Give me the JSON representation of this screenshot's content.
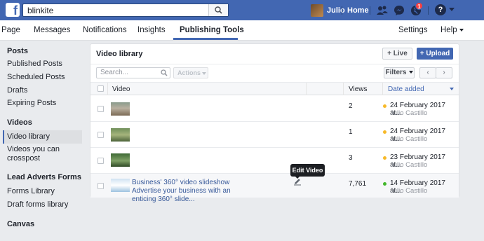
{
  "topbar": {
    "search_value": "blinkite",
    "profile_name": "Julio",
    "home_label": "Home",
    "notification_count": "1",
    "help_symbol": "?"
  },
  "pagenav": {
    "items": [
      "Page",
      "Messages",
      "Notifications",
      "Insights",
      "Publishing Tools"
    ],
    "active": "Publishing Tools",
    "settings_label": "Settings",
    "help_label": "Help"
  },
  "sidebar": {
    "sections": [
      {
        "heading": "Posts",
        "items": [
          "Published Posts",
          "Scheduled Posts",
          "Drafts",
          "Expiring Posts"
        ]
      },
      {
        "heading": "Videos",
        "items": [
          "Video library",
          "Videos you can crosspost"
        ]
      },
      {
        "heading": "Lead Adverts Forms",
        "items": [
          "Forms Library",
          "Draft forms library"
        ]
      },
      {
        "heading": "Canvas",
        "items": []
      }
    ],
    "active_item": "Video library"
  },
  "library": {
    "title": "Video library",
    "live_label": "Live",
    "upload_label": "Upload",
    "search_placeholder": "Search...",
    "actions_label": "Actions",
    "filters_label": "Filters",
    "columns": {
      "video": "Video",
      "views": "Views",
      "date": "Date added"
    },
    "rows": [
      {
        "title": "",
        "views": "2",
        "date": "24 February 2017 at...",
        "author": "Julio Castillo",
        "status_color": "#f7b928"
      },
      {
        "title": "",
        "views": "1",
        "date": "24 February 2017 at...",
        "author": "Julio Castillo",
        "status_color": "#f7b928"
      },
      {
        "title": "",
        "views": "3",
        "date": "23 February 2017 at...",
        "author": "Julio Castillo",
        "status_color": "#f7b928"
      },
      {
        "title": "Business' 360° video slideshow Advertise your business with an enticing 360° slide...",
        "views": "7,761",
        "date": "14 February 2017 at...",
        "author": "Julio Castillo",
        "status_color": "#42b72a"
      }
    ],
    "tooltip": "Edit Video"
  },
  "colors": {
    "brand": "#4267b2",
    "link": "#365899",
    "scheduled": "#f7b928",
    "published": "#42b72a"
  }
}
